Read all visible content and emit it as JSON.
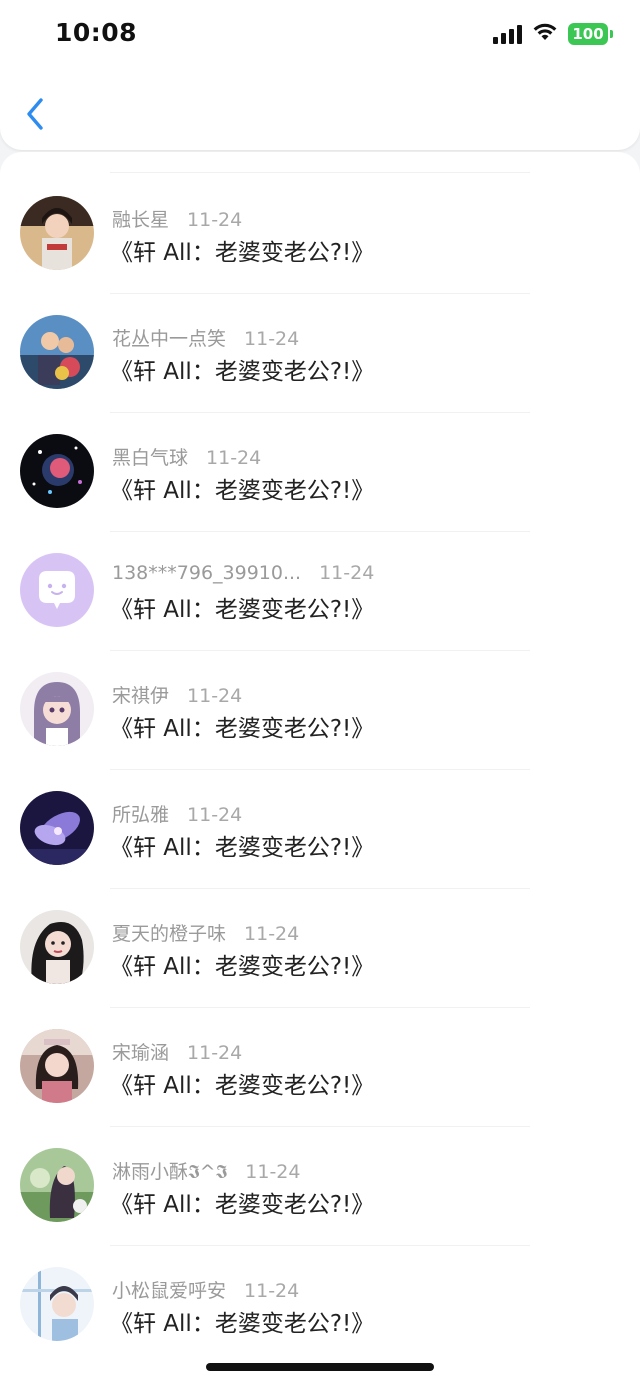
{
  "status_bar": {
    "time": "10:08",
    "battery": "100",
    "icons": [
      "signal-icon",
      "wifi-icon",
      "battery-icon"
    ],
    "battery_color": "#3cc754"
  },
  "header": {
    "back_icon": "chevron-left-icon",
    "accent": "#2d8cf0"
  },
  "messages": [
    {
      "name": "融长星",
      "date": "11-24",
      "text": "《轩 All：老婆变老公?!》"
    },
    {
      "name": "花丛中一点笑",
      "date": "11-24",
      "text": "《轩 All：老婆变老公?!》"
    },
    {
      "name": "黑白气球",
      "date": "11-24",
      "text": "《轩 All：老婆变老公?!》"
    },
    {
      "name": "138***796_39910...",
      "date": "11-24",
      "text": "《轩 All：老婆变老公?!》"
    },
    {
      "name": "宋祺伊",
      "date": "11-24",
      "text": "《轩 All：老婆变老公?!》"
    },
    {
      "name": "所弘雅",
      "date": "11-24",
      "text": "《轩 All：老婆变老公?!》"
    },
    {
      "name": "夏天的橙子味",
      "date": "11-24",
      "text": "《轩 All：老婆变老公?!》"
    },
    {
      "name": "宋瑜涵",
      "date": "11-24",
      "text": "《轩 All：老婆变老公?!》"
    },
    {
      "name": "淋雨小酥𝕴^𝕴",
      "date": "11-24",
      "text": "《轩 All：老婆变老公?!》"
    },
    {
      "name": "小松鼠爱呼安",
      "date": "11-24",
      "text": "《轩 All：老婆变老公?!》"
    }
  ]
}
